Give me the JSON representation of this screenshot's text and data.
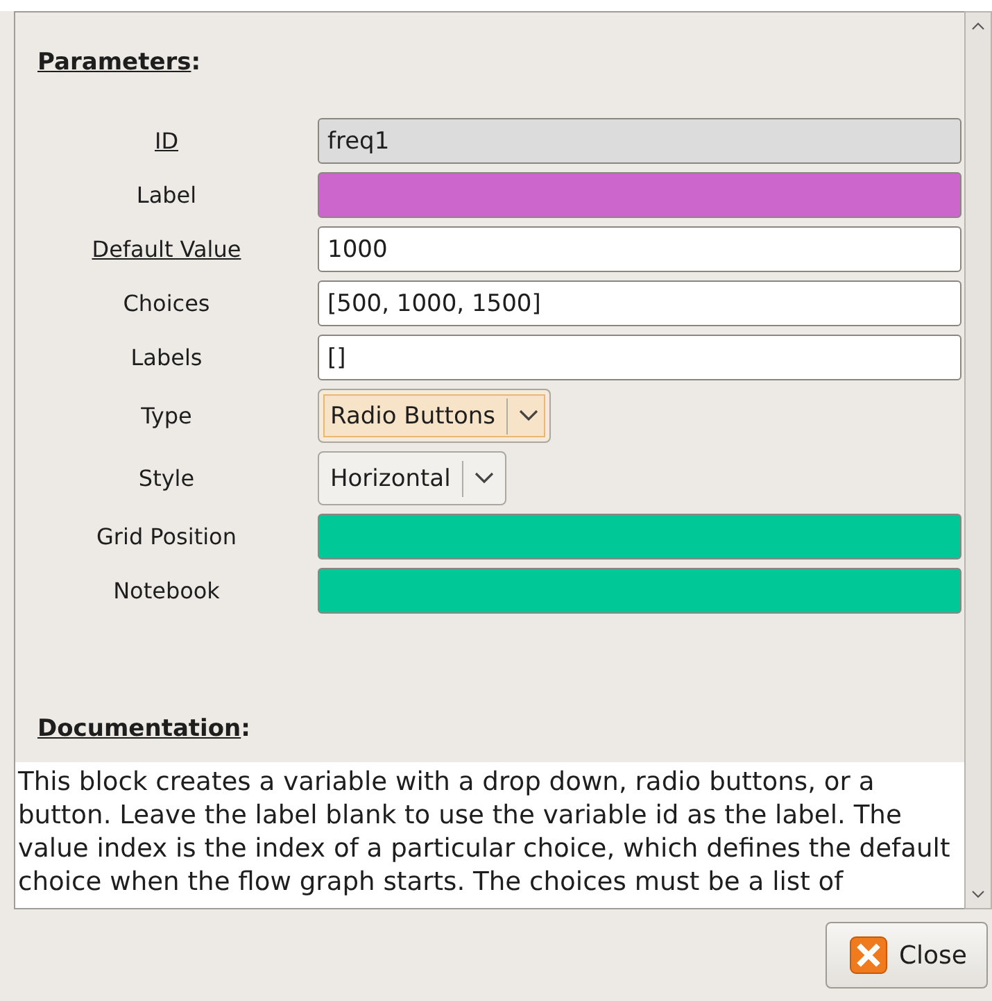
{
  "parameters": {
    "heading": "Parameters",
    "heading_suffix": ":",
    "rows": [
      {
        "kind": "entry",
        "label": "ID",
        "underlined": true,
        "value": "freq1",
        "disabled": true
      },
      {
        "kind": "entry",
        "label": "Label",
        "underlined": false,
        "value": "",
        "color": "#cc66cc"
      },
      {
        "kind": "entry",
        "label": "Default Value",
        "underlined": true,
        "value": "1000",
        "disabled": false
      },
      {
        "kind": "entry",
        "label": "Choices",
        "underlined": false,
        "value": "[500, 1000, 1500]",
        "disabled": false
      },
      {
        "kind": "entry",
        "label": "Labels",
        "underlined": false,
        "value": "[]",
        "disabled": false
      },
      {
        "kind": "combo",
        "label": "Type",
        "underlined": false,
        "value": "Radio Buttons",
        "focused": true
      },
      {
        "kind": "combo",
        "label": "Style",
        "underlined": false,
        "value": "Horizontal",
        "focused": false
      },
      {
        "kind": "entry",
        "label": "Grid Position",
        "underlined": false,
        "value": "",
        "color": "#00c896"
      },
      {
        "kind": "entry",
        "label": "Notebook",
        "underlined": false,
        "value": "",
        "color": "#00c896"
      }
    ]
  },
  "documentation": {
    "heading": "Documentation",
    "heading_suffix": ":",
    "text": "This block creates a variable with a drop down, radio buttons, or a button. Leave the label blank to use the variable id as the label. The value index is the index of a particular choice, which defines the default choice when the flow graph starts. The choices must be a list of"
  },
  "buttons": [
    {
      "label": "Close"
    }
  ]
}
